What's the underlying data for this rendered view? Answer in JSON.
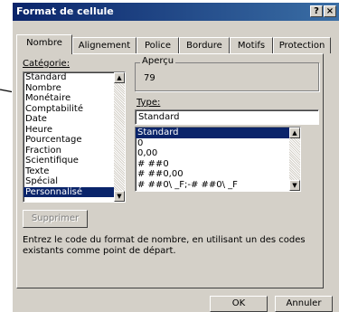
{
  "window": {
    "title": "Format de cellule",
    "help_label": "?",
    "close_label": "×"
  },
  "tabs": [
    {
      "label": "Nombre",
      "active": true
    },
    {
      "label": "Alignement"
    },
    {
      "label": "Police"
    },
    {
      "label": "Bordure"
    },
    {
      "label": "Motifs"
    },
    {
      "label": "Protection"
    }
  ],
  "category": {
    "label": "Catégorie:",
    "items": [
      "Standard",
      "Nombre",
      "Monétaire",
      "Comptabilité",
      "Date",
      "Heure",
      "Pourcentage",
      "Fraction",
      "Scientifique",
      "Texte",
      "Spécial",
      "Personnalisé"
    ],
    "selected": "Personnalisé"
  },
  "apercu": {
    "label": "Aperçu",
    "value": "79"
  },
  "type": {
    "label": "Type:",
    "value": "Standard",
    "items": [
      "Standard",
      "0",
      "0,00",
      "# ##0",
      "# ##0,00",
      "# ##0\\ _F;-# ##0\\ _F"
    ],
    "selected": "Standard"
  },
  "buttons": {
    "supprimer": "Supprimer",
    "ok": "OK",
    "annuler": "Annuler"
  },
  "description": "Entrez le code du format de nombre, en utilisant un des codes existants comme point de départ."
}
